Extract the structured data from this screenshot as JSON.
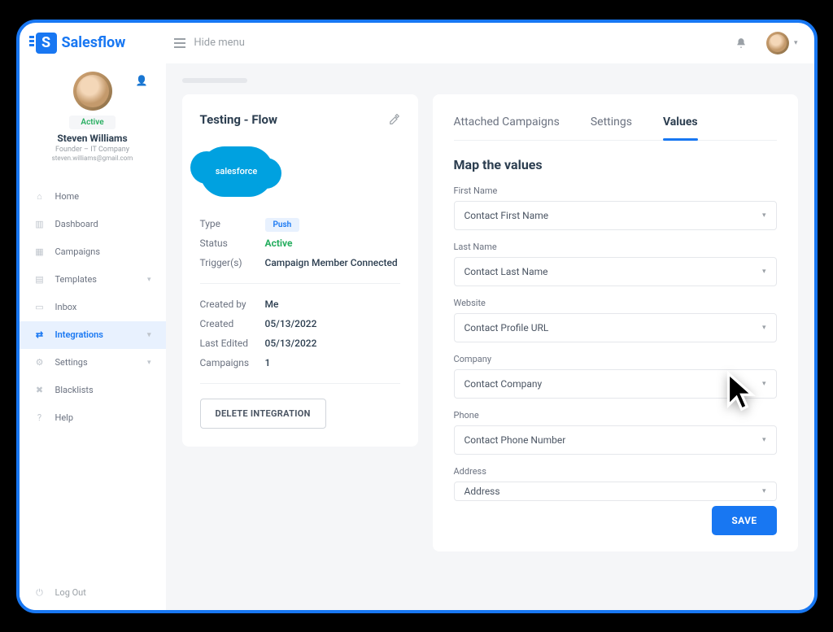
{
  "brand": "Salesflow",
  "hideMenu": "Hide menu",
  "user": {
    "statusBadge": "Active",
    "name": "Steven Williams",
    "role": "Founder – IT Company",
    "email": "steven.williams@gmail.com"
  },
  "nav": {
    "home": "Home",
    "dashboard": "Dashboard",
    "campaigns": "Campaigns",
    "templates": "Templates",
    "inbox": "Inbox",
    "integrations": "Integrations",
    "settings": "Settings",
    "blacklists": "Blacklists",
    "help": "Help",
    "logout": "Log Out"
  },
  "integration": {
    "title": "Testing - Flow",
    "logoText": "salesforce",
    "typeLabel": "Type",
    "typeValue": "Push",
    "statusLabel": "Status",
    "statusValue": "Active",
    "triggersLabel": "Trigger(s)",
    "triggersValue": "Campaign Member Connected",
    "createdByLabel": "Created by",
    "createdByValue": "Me",
    "createdLabel": "Created",
    "createdValue": "05/13/2022",
    "lastEditedLabel": "Last Edited",
    "lastEditedValue": "05/13/2022",
    "campaignsLabel": "Campaigns",
    "campaignsValue": "1",
    "deleteBtn": "DELETE INTEGRATION"
  },
  "tabs": {
    "attached": "Attached Campaigns",
    "settings": "Settings",
    "values": "Values"
  },
  "mapTitle": "Map the values",
  "fields": {
    "firstName": {
      "label": "First Name",
      "value": "Contact First Name"
    },
    "lastName": {
      "label": "Last Name",
      "value": "Contact Last Name"
    },
    "website": {
      "label": "Website",
      "value": "Contact Profile URL"
    },
    "company": {
      "label": "Company",
      "value": "Contact Company"
    },
    "phone": {
      "label": "Phone",
      "value": "Contact Phone Number"
    },
    "address": {
      "label": "Address",
      "value": "Address"
    }
  },
  "saveBtn": "SAVE"
}
